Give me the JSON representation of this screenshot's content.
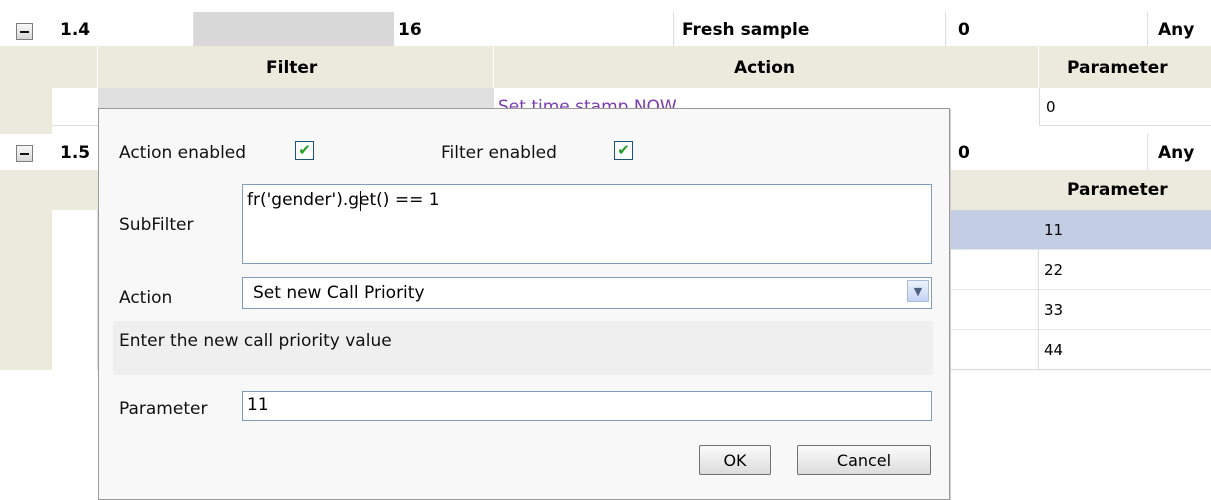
{
  "row14": {
    "id": "1.4",
    "col3": "16",
    "col4": "Fresh sample",
    "col5": "0",
    "col6": "Any"
  },
  "sub14": {
    "headers": [
      "Filter",
      "Action",
      "Parameter"
    ],
    "partial_action": "Set time stamp NOW",
    "parameter_value": "0"
  },
  "row15": {
    "id": "1.5",
    "col5": "0",
    "col6": "Any"
  },
  "sub15": {
    "header": "Parameter",
    "values": [
      "11",
      "22",
      "33",
      "44"
    ]
  },
  "dialog": {
    "action_enabled_label": "Action enabled",
    "filter_enabled_label": "Filter enabled",
    "subfilter_label": "SubFilter",
    "subfilter_value": "fr('gender').get() == 1",
    "action_label": "Action",
    "action_selected": "Set new Call Priority",
    "description": "Enter the new call priority value",
    "parameter_label": "Parameter",
    "parameter_value": "11",
    "ok_label": "OK",
    "cancel_label": "Cancel"
  },
  "colors": {
    "selected_row": "#c3cee5",
    "grid_bg": "#eceadc",
    "checkmark": "#22a022"
  }
}
